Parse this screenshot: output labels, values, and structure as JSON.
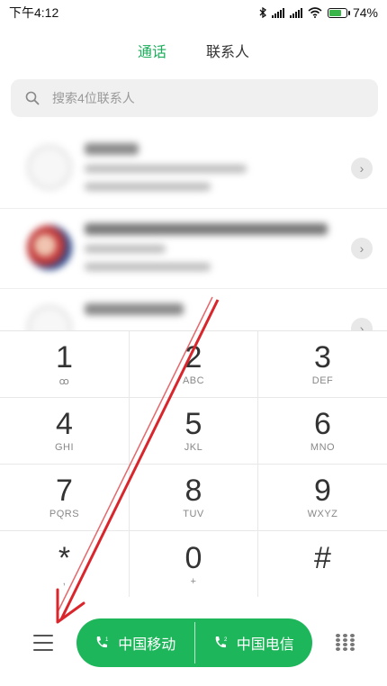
{
  "status": {
    "time": "下午4:12",
    "battery": "74%",
    "battery_level": 0.74
  },
  "tabs": [
    {
      "label": "通话",
      "active": true
    },
    {
      "label": "联系人",
      "active": false
    }
  ],
  "search": {
    "placeholder": "搜索4位联系人"
  },
  "keypad": [
    {
      "digit": "1",
      "letters": "ꝏ"
    },
    {
      "digit": "2",
      "letters": "ABC"
    },
    {
      "digit": "3",
      "letters": "DEF"
    },
    {
      "digit": "4",
      "letters": "GHI"
    },
    {
      "digit": "5",
      "letters": "JKL"
    },
    {
      "digit": "6",
      "letters": "MNO"
    },
    {
      "digit": "7",
      "letters": "PQRS"
    },
    {
      "digit": "8",
      "letters": "TUV"
    },
    {
      "digit": "9",
      "letters": "WXYZ"
    },
    {
      "digit": "*",
      "letters": ","
    },
    {
      "digit": "0",
      "letters": "+"
    },
    {
      "digit": "#",
      "letters": ""
    }
  ],
  "call_buttons": [
    {
      "label": "中国移动",
      "sim": "1"
    },
    {
      "label": "中国电信",
      "sim": "2"
    }
  ],
  "colors": {
    "accent": "#1eb65a",
    "annotation_arrow": "#d9262c"
  }
}
